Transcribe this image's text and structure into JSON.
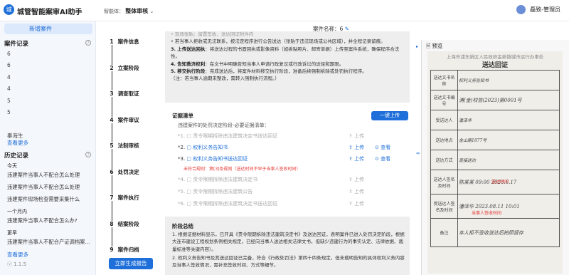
{
  "header": {
    "logo_text": "城",
    "app_title": "城管智能案审AI助手",
    "mode_label": "智能体：",
    "mode_value": "整体审核",
    "mode_caret": "⌄",
    "user_name": "磊致-管理员"
  },
  "sidebar": {
    "new_case_label": "新增案件",
    "case_records_title": "案件记录",
    "case_records": [
      "6",
      "6",
      "4",
      "4",
      "5",
      "5"
    ],
    "case_owner": "秦海生",
    "more_label": "查看更多",
    "history_title": "历史记录",
    "history_groups": [
      {
        "label": "今天",
        "items": [
          "违建案件当事人不配合怎么处理",
          "违建案件当事人不配合怎么处理",
          "违建案件现场检查需要采集什么"
        ]
      },
      {
        "label": "一个月内",
        "items": [
          "违建案件当事人不配合怎么办?"
        ]
      },
      {
        "label": "更早",
        "items": [
          "违建案件当事人不配合产证调档案..."
        ]
      }
    ],
    "more_label2": "查看更多",
    "version": "1.1.5"
  },
  "steps": {
    "items": [
      {
        "num": "1",
        "label": "案件信息"
      },
      {
        "num": "2",
        "label": "立案阶段"
      },
      {
        "num": "3",
        "label": "调查取证"
      },
      {
        "num": "4",
        "label": "案件审议"
      },
      {
        "num": "5",
        "label": "法制审核"
      },
      {
        "num": "6",
        "label": "处罚决定"
      },
      {
        "num": "7",
        "label": "案件执行"
      },
      {
        "num": "8",
        "label": "结案阶段"
      },
      {
        "num": "9",
        "label": "案件归档"
      }
    ],
    "generate_label": "立即生成报告"
  },
  "case_name": {
    "label": "案件名称：6",
    "edit_icon": "✎"
  },
  "notes": {
    "top_cut": "• 现场张贴：留置签收、送达回证附件内",
    "line1": "• 若当事人拒收或无法联系，按法定程序进行公告送达（张贴于违法现场或公共区域），并全程记录留痕。",
    "b3_title": "3. 上传送达回执",
    "b3_text": "：将送达过程的书面回执或影像资料（如拆贴照片、邮寄单据）上传至案件系统，确保程序合法性。",
    "b4_title": "4. 告知救济权利",
    "b4_text": "：在文书中明确告知当事人申请行政复议或行政诉讼的途径和期限。",
    "b5_title": "5. 移交执行阶段",
    "b5_text": "：完成送达后，将案件材料移交执行阶段，准备后续强制拆除或处罚执行程序。",
    "note": "（注：若当事人逾期未整改，需转入强制执行流程。）"
  },
  "evidence": {
    "title": "证据清单",
    "subtitle": "违建案件的处罚决定阶段-必要证据清单：",
    "upload_all": "一键上传",
    "upload_label": "上传",
    "view_label": "查看",
    "docs": [
      {
        "num": "*1.",
        "name": "责令限期拆除违法建筑决定书送达回证",
        "active": false,
        "view": false
      },
      {
        "num": "*2.",
        "name": "权利义务告知书",
        "active": true,
        "view": true
      },
      {
        "num": "*3.",
        "name": "权利义务告知书送达回证",
        "active": true,
        "view": true
      },
      {
        "num": "*4.",
        "name": "责令限期拆除违法建筑决定书",
        "active": false,
        "view": false
      },
      {
        "num": "*5.",
        "name": "责令限期拆除违法建筑公告",
        "active": false,
        "view": false
      },
      {
        "num": "*6.",
        "name": "责令限期拆除违法建筑决定书送达回证",
        "active": false,
        "view": false
      }
    ],
    "warning": "未符合规则：第[3]条规则（送达时间不早于当事人签收时间）"
  },
  "summary": {
    "title": "阶段总结",
    "p1": "1. 根据证据材料显示，已开具《责令限期拆除违法建筑决定书》及送达回证，表明案件已进入处罚决定阶段，根据大连市建设工程规划条例相关规定，已经向当事人送达相关法律文书，但缺少违建行为的事实认定、法律依据、裁量标准等关键内容）。",
    "p2": "2. 权利义务告知书及其送达回证已完备，符合《行政处罚法》第四十四条规定，但未载明告知的具体权利义务内容及当事人签收情况，需补充签收时间、方式等细节。"
  },
  "preview": {
    "title": "预览",
    "doc_header": "上海市浦东新区人民政府金新镇城市运行办事处",
    "doc_title": "送达回证",
    "rows": [
      {
        "label": "送达文书名称",
        "hand": "权利义务告知书"
      },
      {
        "label": "送达文书编号",
        "hand": "浦(金)权告(2023)第0001号"
      },
      {
        "label": "受送达人",
        "hand": "潘泽华"
      },
      {
        "label": "送达地点",
        "hand": "金山路1877号"
      },
      {
        "label": "送达方式",
        "hand": "直接送达"
      },
      {
        "label": "送达人签名及时间",
        "hand": "陈某某 09:00 2023.6.17"
      },
      {
        "label": "受送达人签名及时间",
        "hand": "潘泽华 2023.08.11 10:01"
      },
      {
        "label": "备注",
        "hand": "本人拒不签收送达后拍照留存"
      }
    ],
    "red_note1": "送达时间",
    "red_note2": "当事人签收时间"
  }
}
